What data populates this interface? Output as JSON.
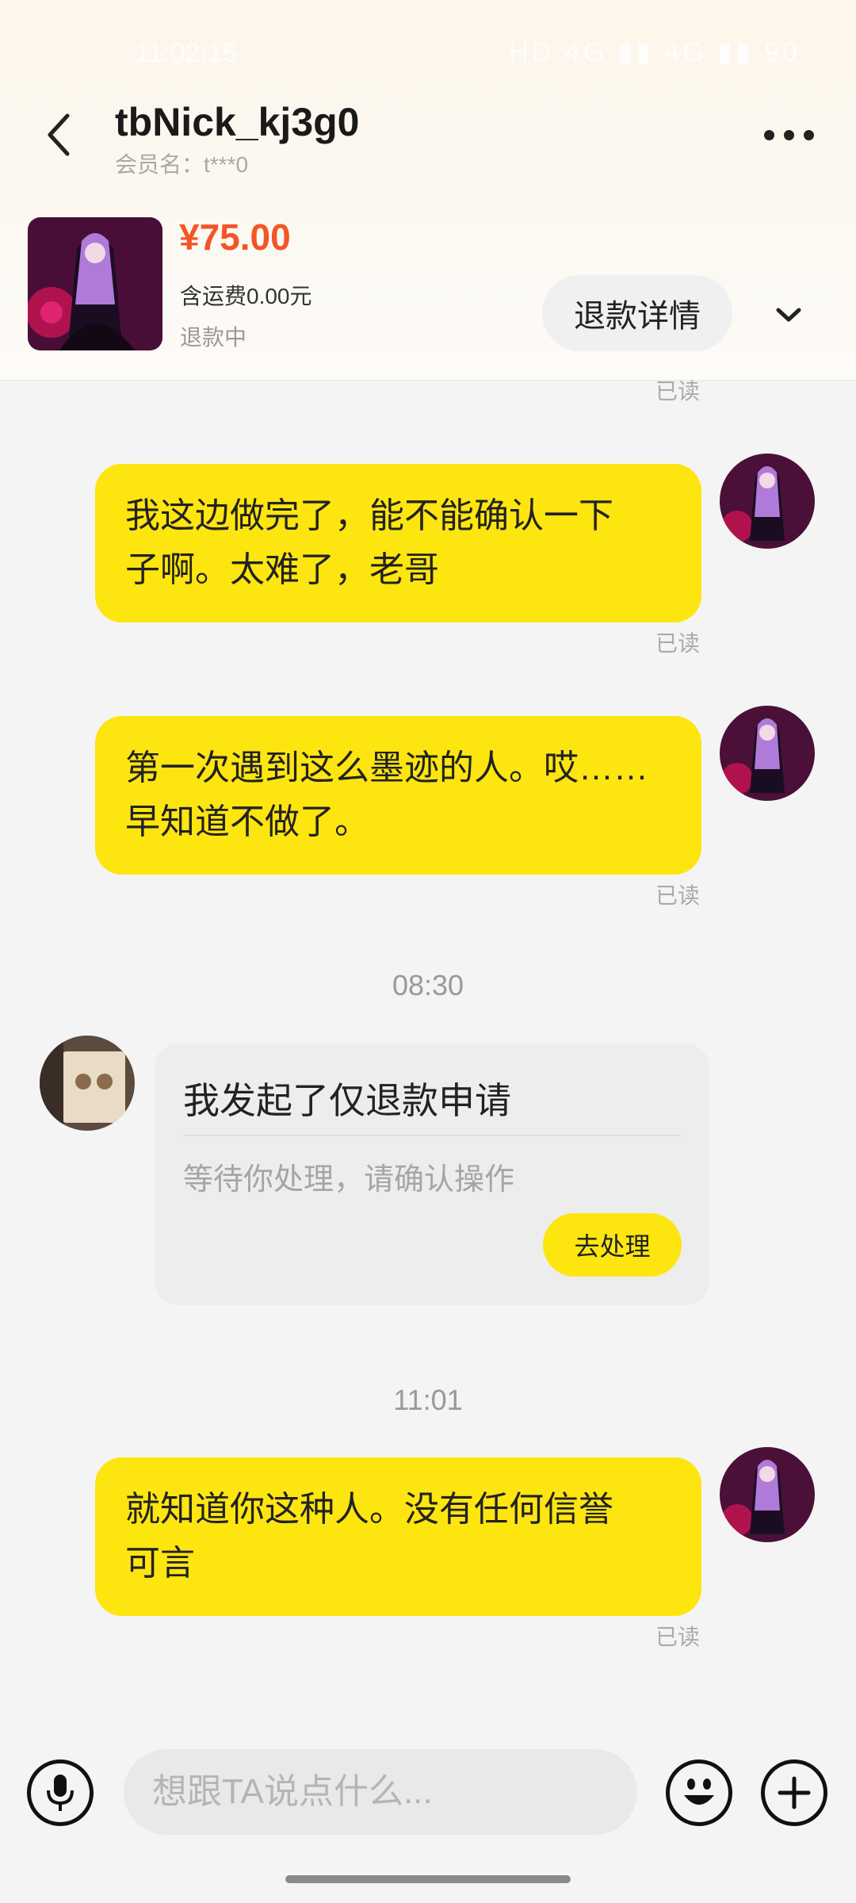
{
  "status_bar": {
    "time": "11:02:15",
    "icons_text": "HD 4G ▮▮ 4G ▮▮ 90"
  },
  "header": {
    "nickname": "tbNick_kj3g0",
    "member_label": "会员名：t***0"
  },
  "order": {
    "price": "¥75.00",
    "shipping": "含运费0.00元",
    "status": "退款中",
    "refund_button": "退款详情"
  },
  "messages": [
    {
      "sender": "me",
      "text_line1": "我这边做完了，能不能确认一下",
      "text_line2": "子啊。太难了，老哥",
      "read": "已读"
    },
    {
      "sender": "me",
      "text_line1": "第一次遇到这么墨迹的人。哎……",
      "text_line2": "早知道不做了。",
      "read": "已读"
    },
    {
      "sender": "me",
      "text_line1": "就知道你这种人。没有任何信誉",
      "text_line2": "可言",
      "read": "已读"
    }
  ],
  "top_read": "已读",
  "timestamps": [
    "08:30",
    "11:01"
  ],
  "refund_card": {
    "title": "我发起了仅退款申请",
    "subtitle": "等待你处理，请确认操作",
    "button": "去处理"
  },
  "input": {
    "placeholder": "想跟TA说点什么..."
  },
  "colors": {
    "accent_yellow": "#fde50f",
    "price_orange": "#f25526"
  },
  "icons": [
    "back-arrow-icon",
    "more-dots-icon",
    "chevron-down-icon",
    "microphone-icon",
    "emoji-icon",
    "plus-icon"
  ]
}
